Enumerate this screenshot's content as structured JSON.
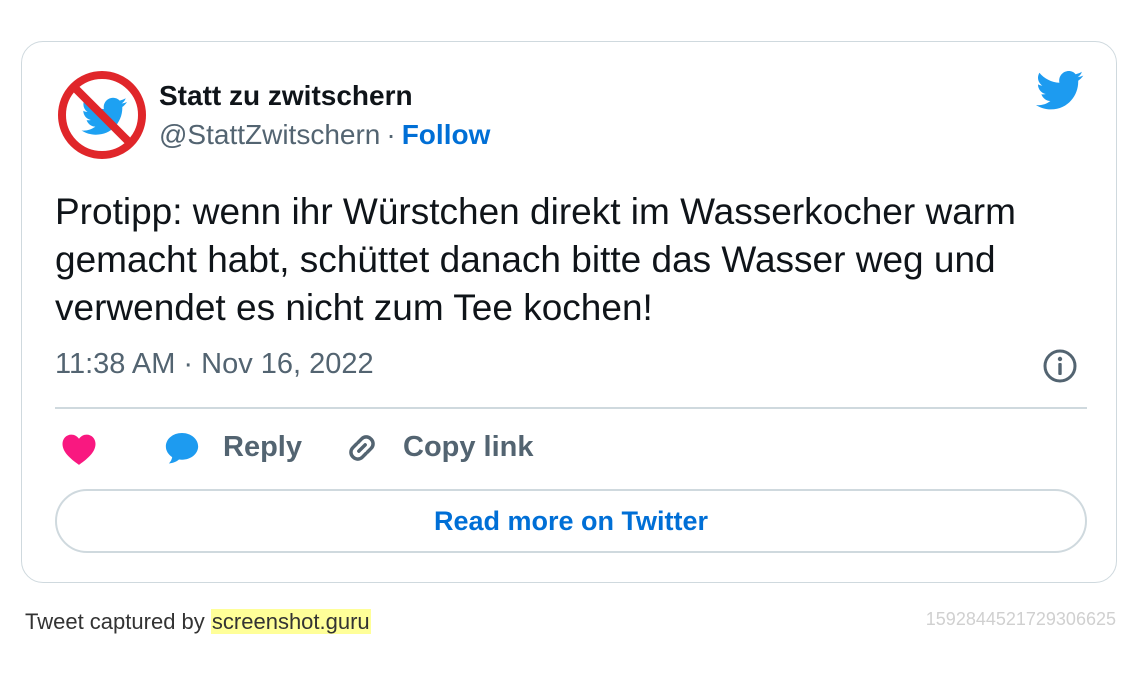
{
  "tweet": {
    "author_name": "Statt zu zwitschern",
    "handle": "@StattZwitschern",
    "separator": "·",
    "follow_label": "Follow",
    "text": "Protipp: wenn ihr Würstchen direkt im Wasserkocher warm gemacht habt, schüttet danach bitte das Wasser weg und verwendet es nicht zum Tee kochen!",
    "timestamp": "11:38 AM · Nov 16, 2022",
    "avatar_icon": "no-bird-avatar",
    "brand_icon": "twitter-bird-icon",
    "info_icon": "info-icon"
  },
  "actions": {
    "like_icon": "heart-icon",
    "reply_label": "Reply",
    "reply_icon": "speech-bubble-icon",
    "copy_link_label": "Copy link",
    "copy_link_icon": "link-icon"
  },
  "read_more_label": "Read more on Twitter",
  "footer": {
    "captured_by": "Tweet captured by",
    "site": "screenshot.guru",
    "tweet_id": "1592844521729306625"
  },
  "colors": {
    "link_blue": "#006fd6",
    "twitter_blue": "#1d9bf0",
    "heart_pink": "#f91880",
    "muted_text": "#536471",
    "border": "#cfd9de",
    "highlight": "#ffff99"
  }
}
